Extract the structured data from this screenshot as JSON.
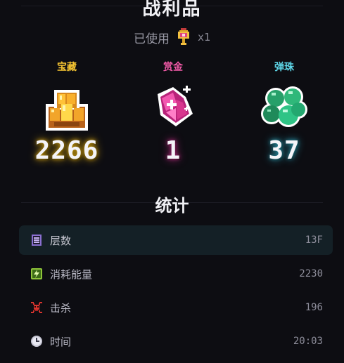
{
  "title": "战利品",
  "used": {
    "label": "已使用",
    "count": "x1",
    "icon": "key-medal-icon"
  },
  "loot": [
    {
      "label": "宝藏",
      "value": "2266",
      "color": "#f5c431",
      "glow": "#c89a10",
      "icon": "gold-nuggets-icon"
    },
    {
      "label": "赏金",
      "value": "1",
      "color": "#f25aa8",
      "glow": "#b02a7a",
      "icon": "pink-crystal-icon"
    },
    {
      "label": "弹珠",
      "value": "37",
      "color": "#5ed6e8",
      "glow": "#2a94a8",
      "icon": "green-marbles-icon"
    }
  ],
  "stats_title": "统计",
  "stats": [
    {
      "label": "层数",
      "value": "13F",
      "icon": "floor-list-icon",
      "highlight": true
    },
    {
      "label": "消耗能量",
      "value": "2230",
      "icon": "energy-bolt-icon",
      "highlight": false
    },
    {
      "label": "击杀",
      "value": "196",
      "icon": "skull-crossbones-icon",
      "highlight": false
    },
    {
      "label": "时间",
      "value": "20:03",
      "icon": "clock-icon",
      "highlight": false
    }
  ]
}
